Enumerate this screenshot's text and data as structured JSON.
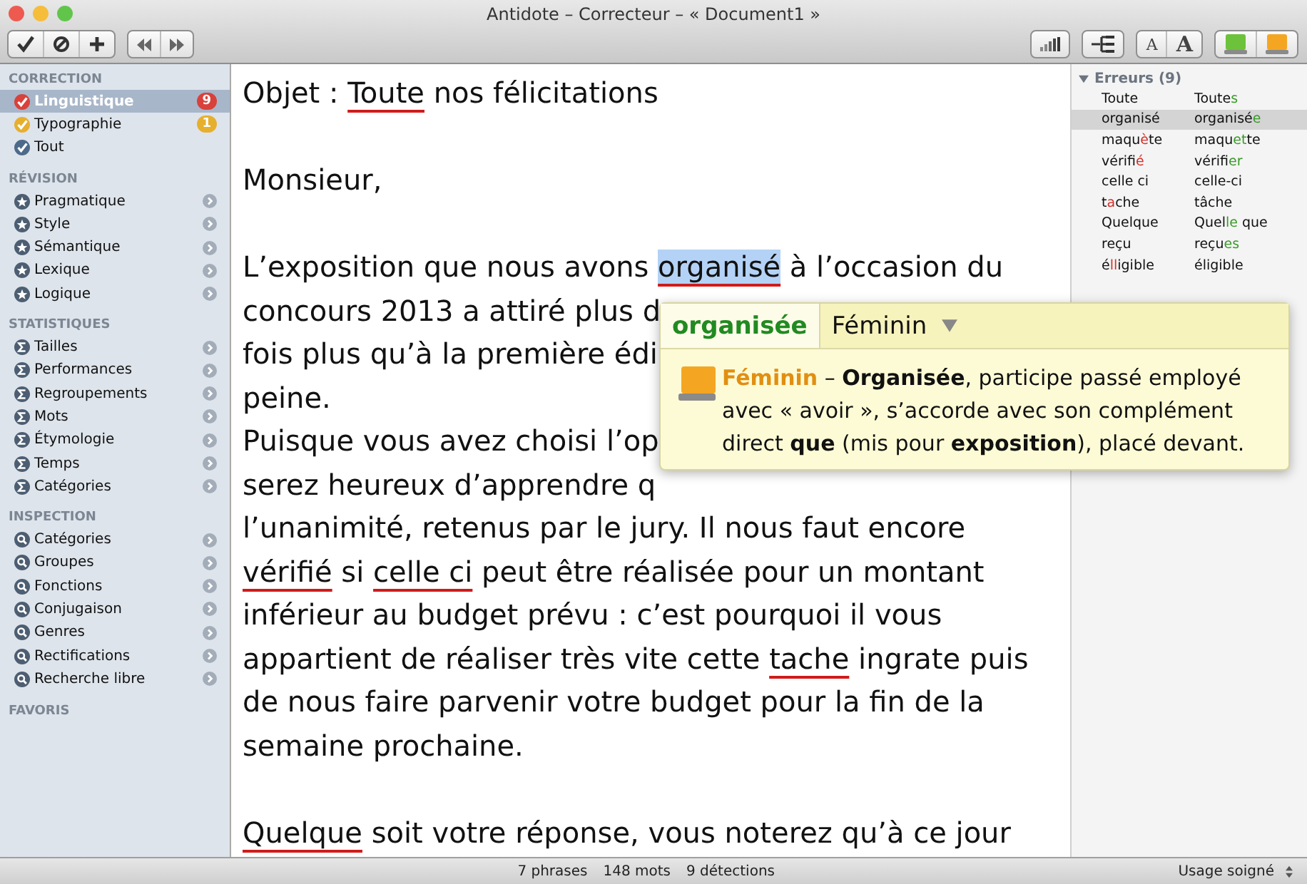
{
  "window": {
    "title": "Antidote – Correcteur – « Document1 »"
  },
  "toolbar": {
    "font_buttons": [
      "A",
      "A"
    ]
  },
  "sidebar": {
    "sections": [
      {
        "title": "CORRECTION",
        "items": [
          {
            "label": "Linguistique",
            "kind": "check",
            "color": "#d9413b",
            "selected": true,
            "badge": "9"
          },
          {
            "label": "Typographie",
            "kind": "check",
            "color": "#e6b02e",
            "selected": false,
            "badge": "1"
          },
          {
            "label": "Tout",
            "kind": "check",
            "color": "#4d6a8a",
            "selected": false
          }
        ]
      },
      {
        "title": "RÉVISION",
        "items": [
          {
            "label": "Pragmatique",
            "kind": "star",
            "selected": false,
            "arrow": true
          },
          {
            "label": "Style",
            "kind": "star",
            "selected": false,
            "arrow": true
          },
          {
            "label": "Sémantique",
            "kind": "star",
            "selected": false,
            "arrow": true
          },
          {
            "label": "Lexique",
            "kind": "star",
            "selected": false,
            "arrow": true
          },
          {
            "label": "Logique",
            "kind": "star",
            "selected": false,
            "arrow": true
          }
        ]
      },
      {
        "title": "STATISTIQUES",
        "items": [
          {
            "label": "Tailles",
            "kind": "sigma",
            "selected": false,
            "arrow": true
          },
          {
            "label": "Performances",
            "kind": "sigma",
            "selected": false,
            "arrow": true
          },
          {
            "label": "Regroupements",
            "kind": "sigma",
            "selected": false,
            "arrow": true
          },
          {
            "label": "Mots",
            "kind": "sigma",
            "selected": false,
            "arrow": true
          },
          {
            "label": "Étymologie",
            "kind": "sigma",
            "selected": false,
            "arrow": true
          },
          {
            "label": "Temps",
            "kind": "sigma",
            "selected": false,
            "arrow": true
          },
          {
            "label": "Catégories",
            "kind": "sigma",
            "selected": false,
            "arrow": true
          }
        ]
      },
      {
        "title": "INSPECTION",
        "items": [
          {
            "label": "Catégories",
            "kind": "search",
            "selected": false,
            "arrow": true
          },
          {
            "label": "Groupes",
            "kind": "search",
            "selected": false,
            "arrow": true
          },
          {
            "label": "Fonctions",
            "kind": "search",
            "selected": false,
            "arrow": true
          },
          {
            "label": "Conjugaison",
            "kind": "search",
            "selected": false,
            "arrow": true
          },
          {
            "label": "Genres",
            "kind": "search",
            "selected": false,
            "arrow": true
          },
          {
            "label": "Rectifications",
            "kind": "search",
            "selected": false,
            "arrow": true
          },
          {
            "label": "Recherche libre",
            "kind": "search",
            "selected": false,
            "arrow": true
          }
        ]
      },
      {
        "title": "FAVORIS"
      }
    ]
  },
  "document": {
    "paragraphs": [
      {
        "lines": [
          [
            {
              "t": "Objet : "
            },
            {
              "t": "Toute",
              "error": true
            },
            {
              "t": " nos félicitations"
            }
          ]
        ]
      },
      {
        "lines": [
          [
            {
              "t": "Monsieur,"
            }
          ]
        ]
      },
      {
        "lines": [
          [
            {
              "t": "L’exposition que nous avons "
            },
            {
              "t": "organisé",
              "error": true,
              "selected": true
            },
            {
              "t": " à l’occasion du"
            }
          ],
          [
            {
              "t": "concours 2013 a attiré plus d"
            }
          ],
          [
            {
              "t": "fois plus qu’à la première édi"
            }
          ],
          [
            {
              "t": "peine."
            }
          ],
          [
            {
              "t": "Puisque vous avez choisi l’op"
            }
          ],
          [
            {
              "t": "serez heureux d’apprendre q"
            }
          ],
          [
            {
              "t": "l’unanimité, retenus par le jury. Il nous faut encore"
            }
          ],
          [
            {
              "t": "vérifié",
              "error": true
            },
            {
              "t": " si "
            },
            {
              "t": "celle ci",
              "error": true
            },
            {
              "t": " peut être réalisée pour un montant"
            }
          ],
          [
            {
              "t": "inférieur au budget prévu : c’est pourquoi il vous"
            }
          ],
          [
            {
              "t": "appartient de réaliser très vite cette "
            },
            {
              "t": "tache",
              "error": true
            },
            {
              "t": " ingrate puis"
            }
          ],
          [
            {
              "t": "de nous faire parvenir votre budget pour la fin de la"
            }
          ],
          [
            {
              "t": "semaine prochaine."
            }
          ]
        ]
      },
      {
        "lines": [
          [
            {
              "t": "Quelque",
              "error": true
            },
            {
              "t": " soit votre réponse, vous noterez qu’à ce jour"
            }
          ]
        ]
      }
    ]
  },
  "popup": {
    "word_text": "organisée",
    "category": "Féminin",
    "label": "Féminin",
    "explanation": " – **Organisée**, participe passé employé avec « avoir », s’accorde avec son complément direct **que** (mis pour **exposition**), placé devant."
  },
  "errors_panel": {
    "title": "Erreurs (9)",
    "expanded": true,
    "rows": [
      {
        "selected": false,
        "original": [
          {
            "t": "Toute"
          }
        ],
        "suggestion": [
          {
            "t": "Toute"
          },
          {
            "t": "s",
            "mark": true
          }
        ]
      },
      {
        "selected": true,
        "original": [
          {
            "t": "organisé"
          }
        ],
        "suggestion": [
          {
            "t": "organisé"
          },
          {
            "t": "e",
            "mark": true
          }
        ]
      },
      {
        "selected": false,
        "original": [
          {
            "t": "maqu"
          },
          {
            "t": "è",
            "mark": true
          },
          {
            "t": "te"
          }
        ],
        "suggestion": [
          {
            "t": "maqu"
          },
          {
            "t": "et",
            "mark": true
          },
          {
            "t": "te"
          }
        ]
      },
      {
        "selected": false,
        "original": [
          {
            "t": "vérifi"
          },
          {
            "t": "é",
            "mark": true
          }
        ],
        "suggestion": [
          {
            "t": "vérifi"
          },
          {
            "t": "er",
            "mark": true
          }
        ]
      },
      {
        "selected": false,
        "original": [
          {
            "t": "celle ci"
          }
        ],
        "suggestion": [
          {
            "t": "celle-ci"
          }
        ]
      },
      {
        "selected": false,
        "original": [
          {
            "t": "t"
          },
          {
            "t": "a",
            "mark": true
          },
          {
            "t": "che"
          }
        ],
        "suggestion": [
          {
            "t": "tâche"
          }
        ]
      },
      {
        "selected": false,
        "original": [
          {
            "t": "Quelque"
          }
        ],
        "suggestion": [
          {
            "t": "Quel"
          },
          {
            "t": "le",
            "mark": true
          },
          {
            "t": " que"
          }
        ]
      },
      {
        "selected": false,
        "original": [
          {
            "t": "reçu"
          }
        ],
        "suggestion": [
          {
            "t": "reçu"
          },
          {
            "t": "es",
            "mark": true
          }
        ]
      },
      {
        "selected": false,
        "original": [
          {
            "t": "é"
          },
          {
            "t": "ll",
            "mark": true
          },
          {
            "t": "igible"
          }
        ],
        "suggestion": [
          {
            "t": "éligible"
          }
        ]
      }
    ]
  },
  "status_bar": {
    "phrases": "7 phrases",
    "words": "148 mots",
    "detections": "9 détections",
    "usage": "Usage soigné"
  }
}
